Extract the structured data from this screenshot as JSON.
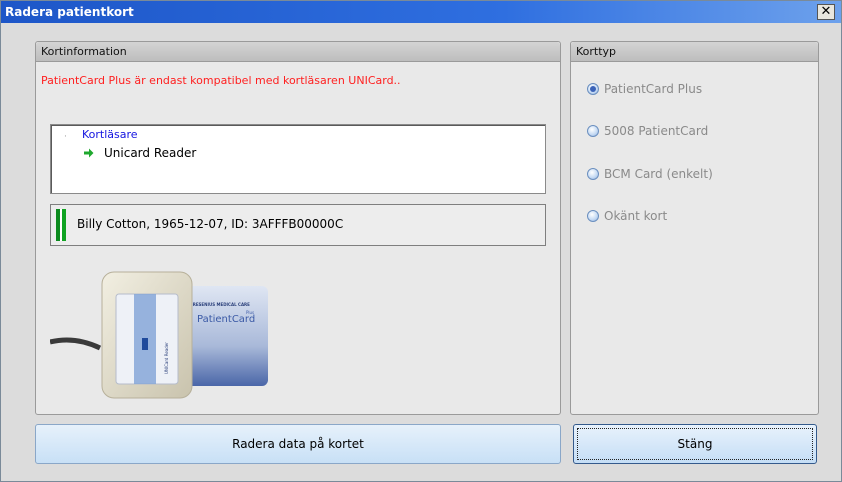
{
  "window": {
    "title": "Radera patientkort"
  },
  "card_info": {
    "header": "Kortinformation",
    "warning": "PatientCard Plus är endast kompatibel med kortläsaren UNICard..",
    "reader_tree": {
      "root": "Kortläsare",
      "child": "Unicard Reader"
    },
    "card_details": "Billy Cotton, 1965-12-07, ID: 3AFFFB00000C"
  },
  "illustration": {
    "card_brand": "FRESENIUS MEDICAL CARE",
    "card_name": "PatientCard",
    "card_plus": "Plus",
    "reader_label": "UNICard Reader"
  },
  "card_type": {
    "header": "Korttyp",
    "options": [
      {
        "label": "PatientCard Plus",
        "checked": true
      },
      {
        "label": "5008 PatientCard",
        "checked": false
      },
      {
        "label": "BCM Card (enkelt)",
        "checked": false
      },
      {
        "label": "Okänt kort",
        "checked": false
      }
    ]
  },
  "buttons": {
    "delete": "Radera data på kortet",
    "close": "Stäng"
  },
  "colors": {
    "title_bar": "#2f6fe0",
    "warning": "#ff2020",
    "link_blue": "#1414e0",
    "indicator_green": "#10a322"
  }
}
